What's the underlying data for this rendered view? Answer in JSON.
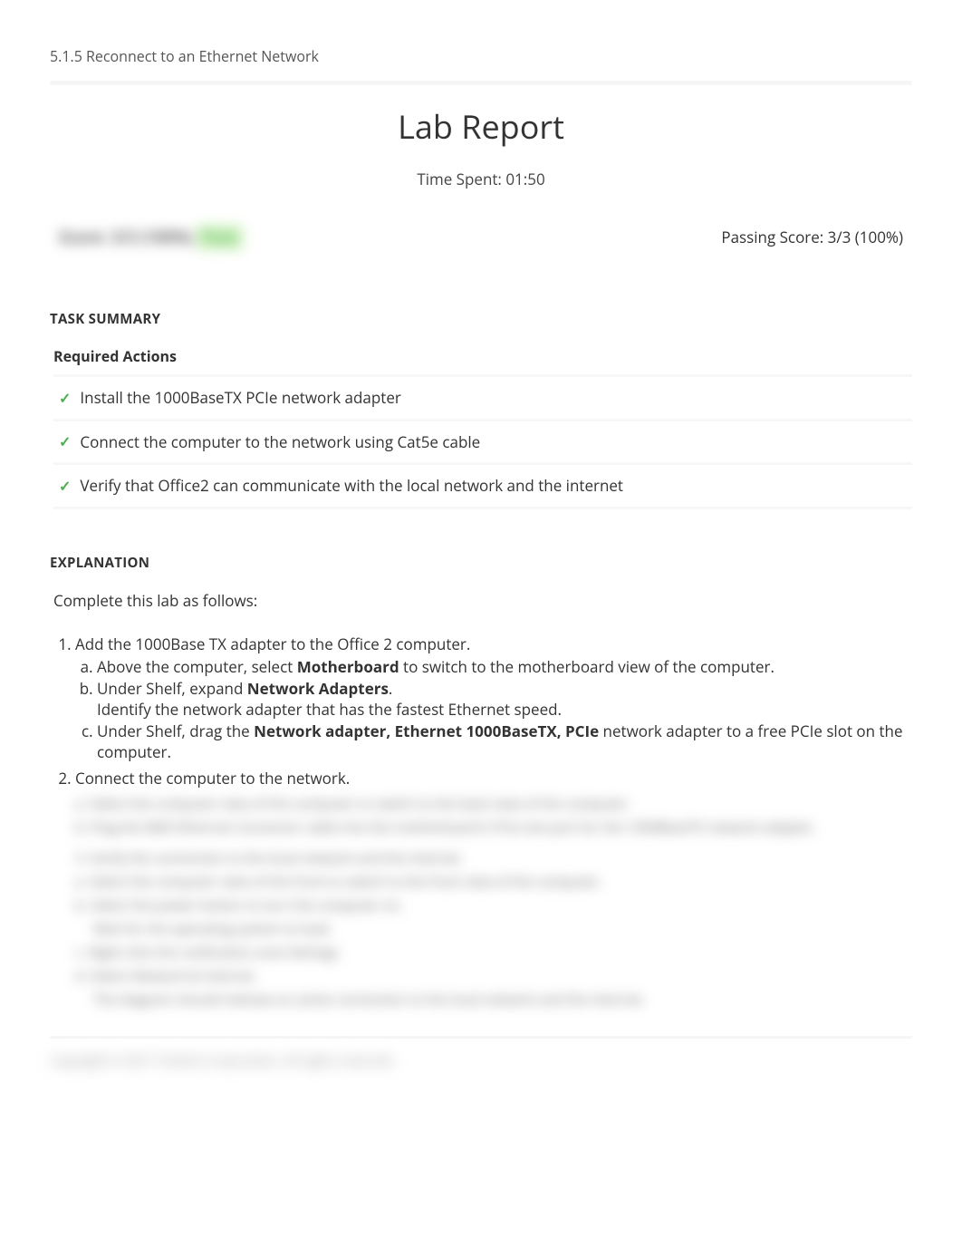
{
  "breadcrumb": "5.1.5 Reconnect to an Ethernet Network",
  "title": "Lab Report",
  "time_spent_label": "Time Spent: 01:50",
  "score_hidden": {
    "prefix": "Score: 3/3 (100%)",
    "suffix": "Pass"
  },
  "passing_score": "Passing Score: 3/3 (100%)",
  "task_summary_header": "TASK SUMMARY",
  "required_actions_header": "Required Actions",
  "tasks": [
    "Install the 1000BaseTX PCIe network adapter",
    "Connect the computer to the network using Cat5e cable",
    "Verify that Office2 can communicate with the local network and the internet"
  ],
  "explanation_header": "EXPLANATION",
  "explanation_intro": "Complete this lab as follows:",
  "steps": [
    {
      "text": "Add the 1000Base TX adapter to the Office 2 computer.",
      "substeps": [
        {
          "pre": "Above the computer, select ",
          "bold": "Motherboard",
          "post": " to switch to the motherboard view of the computer."
        },
        {
          "pre": "Under Shelf, expand ",
          "bold": "Network Adapters",
          "post": ".",
          "line2": "Identify the network adapter that has the fastest Ethernet speed."
        },
        {
          "pre": "Under Shelf, drag the ",
          "bold": "Network adapter, Ethernet 1000BaseTX, PCIe",
          "post": " network adapter to a free PCIe slot on the computer."
        }
      ]
    },
    {
      "text": "Connect the computer to the network."
    }
  ],
  "blurred_lines": [
    "a. Select the computer view of the computer to switch to the back view of the computer.",
    "b. Plug the RJ45 Ethernet Connector cable into the motherboard's PCIe slot port for the 1000BaseTX network adapter.",
    "3. Verify the connection to the local network and the internet.",
    "a. Select the computer view of the front to switch to the front view of the computer.",
    "b. Select the power button to turn the computer on.",
    "Wait for the operating system to load.",
    "c. Right-click the notification area Settings.",
    "d. Select Network & Internet.",
    "The diagram should indicate an active connection to the local network and the internet."
  ],
  "footer": "Copyright © 2021 TestOut Corporation. All rights reserved."
}
